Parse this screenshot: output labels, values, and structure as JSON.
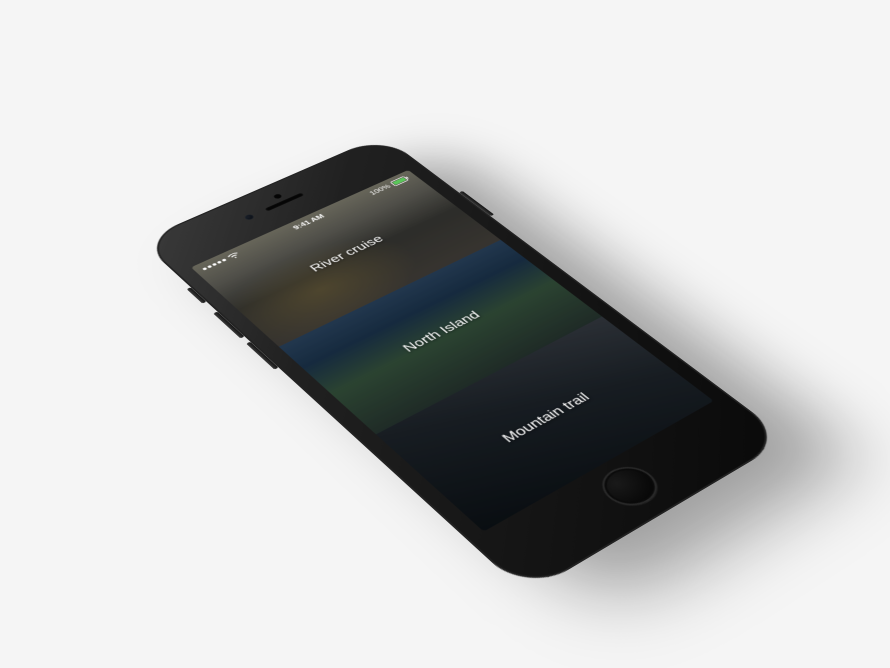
{
  "status_bar": {
    "time": "9:41 AM",
    "battery_pct": "100%",
    "carrier_dots": 5
  },
  "list": {
    "cards": [
      {
        "title": "River cruise"
      },
      {
        "title": "North Island"
      },
      {
        "title": "Mountain trail"
      }
    ]
  }
}
